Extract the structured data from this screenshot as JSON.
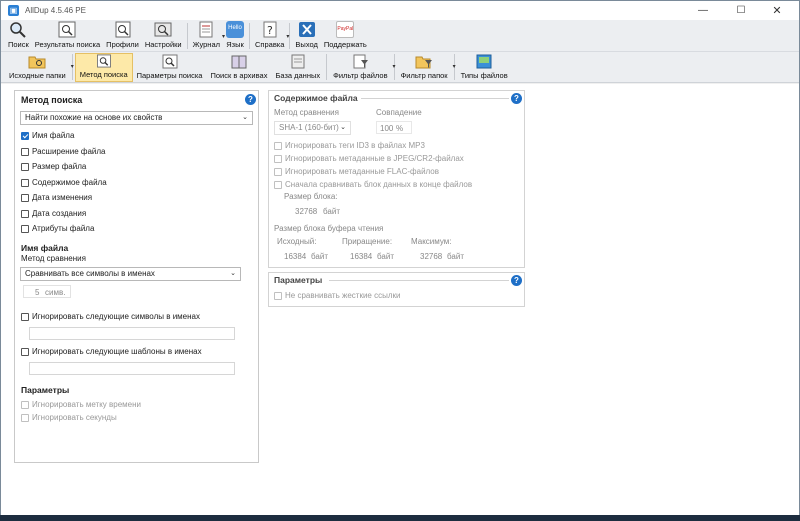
{
  "window": {
    "title": "AllDup 4.5.46 PE",
    "minimize": "—",
    "maximize": "☐",
    "close": "✕"
  },
  "toolbar_main": {
    "search": "Поиск",
    "results": "Результаты поиска",
    "profiles": "Профили",
    "settings": "Настройки",
    "journal": "Журнал",
    "language": "Язык",
    "help": "Справка",
    "exit": "Выход",
    "support": "Поддержать",
    "language_icon_text": "Hello",
    "support_icon_text": "PayPal"
  },
  "toolbar_sub": {
    "source_folders": "Исходные папки",
    "search_method": "Метод поиска",
    "search_params": "Параметры поиска",
    "archive_search": "Поиск в архивах",
    "database": "База данных",
    "file_filter": "Фильтр файлов",
    "folder_filter": "Фильтр папок",
    "file_types": "Типы файлов"
  },
  "left_panel": {
    "title": "Метод поиска",
    "help_glyph": "?",
    "method_value": "Найти похожие на основе их свойств",
    "criteria": [
      {
        "label": "Имя файла",
        "checked": true
      },
      {
        "label": "Расширение файла",
        "checked": false
      },
      {
        "label": "Размер файла",
        "checked": false
      },
      {
        "label": "Содержимое файла",
        "checked": false
      },
      {
        "label": "Дата изменения",
        "checked": false
      },
      {
        "label": "Дата создания",
        "checked": false
      },
      {
        "label": "Атрибуты файла",
        "checked": false
      }
    ],
    "filename_header": "Имя файла",
    "compare_method_label": "Метод сравнения",
    "compare_method_value": "Сравнивать все символы в именах",
    "chars_count": "5",
    "chars_unit": "симв.",
    "ignore_chars_label": "Игнорировать следующие символы в именах",
    "ignore_patterns_label": "Игнорировать следующие шаблоны в именах",
    "params_header": "Параметры",
    "ignore_timestamp": "Игнорировать метку времени",
    "ignore_seconds": "Игнорировать секунды"
  },
  "right_panel": {
    "title": "Содержимое файла",
    "help_glyph": "?",
    "compare_method_label": "Метод сравнения",
    "compare_method_value": "SHA-1 (160-бит)",
    "match_label": "Совпадение",
    "match_value": "100",
    "match_unit": "%",
    "options": [
      "Игнорировать теги ID3 в файлах MP3",
      "Игнорировать метаданные в JPEG/CR2-файлах",
      "Игнорировать метаданные FLAC-файлов",
      "Сначала сравнивать блок данных в конце файлов"
    ],
    "block_size_label": "Размер блока:",
    "block_size_value": "32768",
    "block_size_unit": "байт",
    "buffer_label": "Размер блока буфера чтения",
    "initial_label": "Исходный:",
    "initial_value": "16384",
    "increment_label": "Приращение:",
    "increment_value": "16384",
    "max_label": "Максимум:",
    "max_value": "32768",
    "unit": "байт"
  },
  "params_panel": {
    "title": "Параметры",
    "help_glyph": "?",
    "no_hardlinks": "Не сравнивать жесткие ссылки"
  }
}
